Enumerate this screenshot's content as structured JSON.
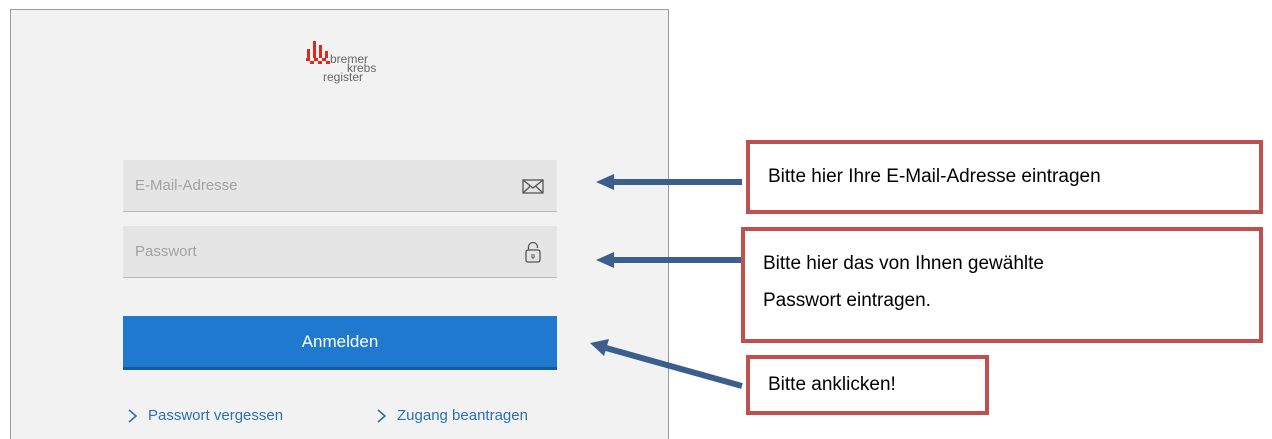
{
  "logo": {
    "line1": "bremer",
    "line2": "krebs",
    "line3": "register",
    "colors": {
      "red": "#e1261c",
      "text": "#666666"
    }
  },
  "form": {
    "email": {
      "placeholder": "E-Mail-Adresse",
      "value": "",
      "icon": "envelope-icon"
    },
    "password": {
      "placeholder": "Passwort",
      "value": "",
      "icon": "lock-icon"
    },
    "submit_label": "Anmelden",
    "links": {
      "forgot_password": "Passwort vergessen",
      "request_access": "Zugang beantragen"
    }
  },
  "annotations": {
    "email_hint": "Bitte hier Ihre E-Mail-Adresse eintragen",
    "password_hint_line1": "Bitte hier das von Ihnen gewählte",
    "password_hint_line2": "Passwort eintragen.",
    "click_hint": "Bitte anklicken!"
  },
  "colors": {
    "primary": "#1f79cf",
    "link": "#2b6fb6",
    "callout_border": "#c0504d",
    "arrow": "#3b5e8c"
  }
}
